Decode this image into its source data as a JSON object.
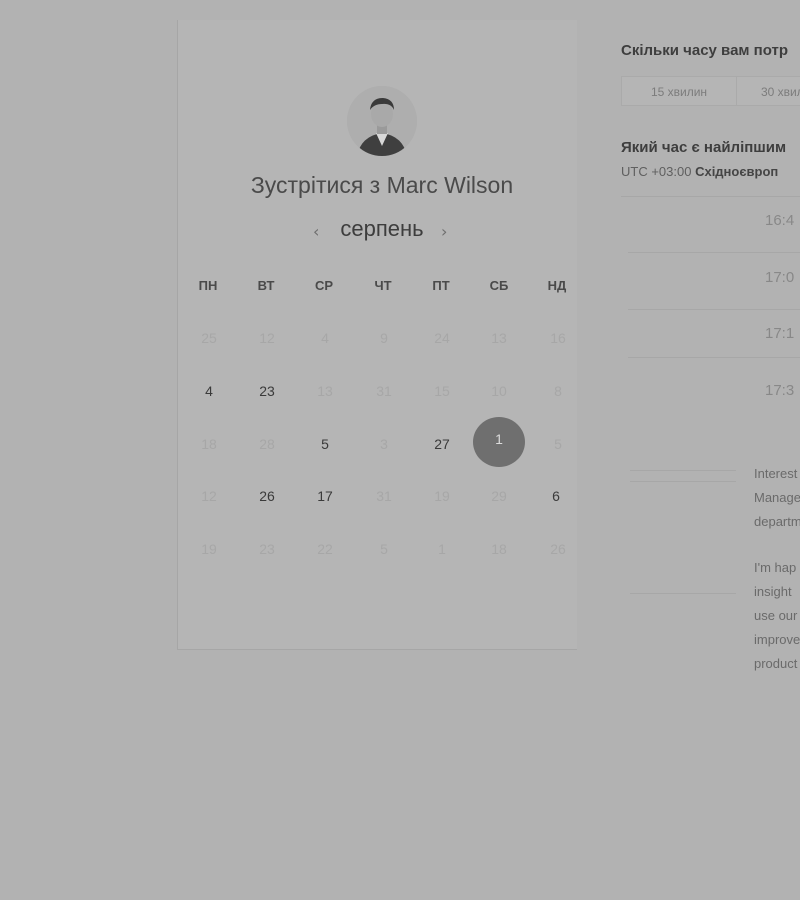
{
  "booking": {
    "title": "Зустрітися з Marc Wilson",
    "month": "серпень",
    "weekdays": [
      "ПН",
      "ВТ",
      "СР",
      "ЧТ",
      "ПТ",
      "СБ",
      "НД"
    ],
    "weeks": [
      [
        "25",
        "12",
        "4",
        "9",
        "24",
        "13",
        "16"
      ],
      [
        "4",
        "23",
        "13",
        "31",
        "15",
        "10",
        "8"
      ],
      [
        "18",
        "28",
        "5",
        "3",
        "27",
        "1",
        "5"
      ],
      [
        "12",
        "26",
        "17",
        "31",
        "19",
        "29",
        "6"
      ],
      [
        "19",
        "23",
        "22",
        "5",
        "1",
        "18",
        "26"
      ]
    ],
    "selected_day": "1"
  },
  "panel": {
    "duration_question": "Скільки часу вам потр",
    "durations": [
      "15 хвилин",
      "30 хвил"
    ],
    "time_question": "Який час є найліпшим",
    "timezone_prefix": "UTC +03:00",
    "timezone_name": "Східноєвроп",
    "slots": [
      "16:4",
      "17:0",
      "17:1",
      "17:3"
    ],
    "notes": [
      "Interest",
      "Manage",
      "departm",
      "I'm hap",
      "insight",
      "use our",
      "improve",
      "product"
    ]
  }
}
